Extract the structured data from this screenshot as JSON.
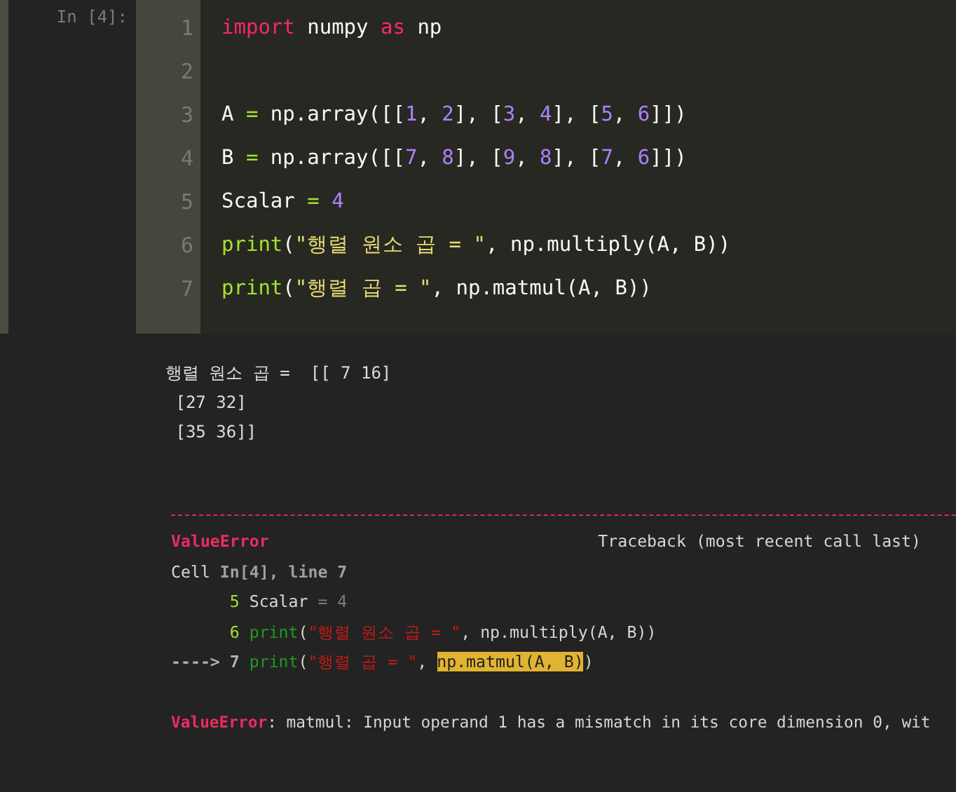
{
  "cell": {
    "prompt": "In [4]:",
    "lines": [
      {
        "number": "1",
        "tokens": [
          {
            "kind": "kw",
            "text": "import"
          },
          {
            "kind": "plain",
            "text": " numpy "
          },
          {
            "kind": "kw",
            "text": "as"
          },
          {
            "kind": "plain",
            "text": " np"
          }
        ]
      },
      {
        "number": "2"
      },
      {
        "number": "3",
        "tokens": [
          {
            "kind": "plain",
            "text": "A "
          },
          {
            "kind": "op",
            "text": "="
          },
          {
            "kind": "plain",
            "text": " np.array([["
          },
          {
            "kind": "num",
            "text": "1"
          },
          {
            "kind": "plain",
            "text": ", "
          },
          {
            "kind": "num",
            "text": "2"
          },
          {
            "kind": "plain",
            "text": "], ["
          },
          {
            "kind": "num",
            "text": "3"
          },
          {
            "kind": "plain",
            "text": ", "
          },
          {
            "kind": "num",
            "text": "4"
          },
          {
            "kind": "plain",
            "text": "], ["
          },
          {
            "kind": "num",
            "text": "5"
          },
          {
            "kind": "plain",
            "text": ", "
          },
          {
            "kind": "num",
            "text": "6"
          },
          {
            "kind": "plain",
            "text": "]])"
          }
        ]
      },
      {
        "number": "4",
        "tokens": [
          {
            "kind": "plain",
            "text": "B "
          },
          {
            "kind": "op",
            "text": "="
          },
          {
            "kind": "plain",
            "text": " np.array([["
          },
          {
            "kind": "num",
            "text": "7"
          },
          {
            "kind": "plain",
            "text": ", "
          },
          {
            "kind": "num",
            "text": "8"
          },
          {
            "kind": "plain",
            "text": "], ["
          },
          {
            "kind": "num",
            "text": "9"
          },
          {
            "kind": "plain",
            "text": ", "
          },
          {
            "kind": "num",
            "text": "8"
          },
          {
            "kind": "plain",
            "text": "], ["
          },
          {
            "kind": "num",
            "text": "7"
          },
          {
            "kind": "plain",
            "text": ", "
          },
          {
            "kind": "num",
            "text": "6"
          },
          {
            "kind": "plain",
            "text": "]])"
          }
        ]
      },
      {
        "number": "5",
        "tokens": [
          {
            "kind": "plain",
            "text": "Scalar "
          },
          {
            "kind": "op",
            "text": "= "
          },
          {
            "kind": "num",
            "text": "4"
          }
        ]
      },
      {
        "number": "6",
        "tokens": [
          {
            "kind": "func",
            "text": "print"
          },
          {
            "kind": "plain",
            "text": "("
          },
          {
            "kind": "str",
            "text": "\"행렬 원소 곱 = \""
          },
          {
            "kind": "plain",
            "text": ", np.multiply(A, B))"
          }
        ]
      },
      {
        "number": "7",
        "tokens": [
          {
            "kind": "func",
            "text": "print"
          },
          {
            "kind": "plain",
            "text": "("
          },
          {
            "kind": "str",
            "text": "\"행렬 곱 = \""
          },
          {
            "kind": "plain",
            "text": ", np.matmul(A, B))"
          }
        ]
      }
    ]
  },
  "output": {
    "lines": [
      "행렬 원소 곱 =  [[ 7 16]",
      " [27 32]",
      " [35 36]]"
    ]
  },
  "traceback": {
    "error_name": "ValueError",
    "header": "Traceback (most recent call last)",
    "location": [
      {
        "kind": "plain",
        "text": "Cell "
      },
      {
        "kind": "loc",
        "text": "In[4], line 7"
      }
    ],
    "lines": [
      [
        {
          "kind": "lineno",
          "text": "5"
        },
        {
          "kind": "plain",
          "text": " Scalar "
        },
        {
          "kind": "dim",
          "text": "= 4"
        }
      ],
      [
        {
          "kind": "lineno",
          "text": "6"
        },
        {
          "kind": "func",
          "text": " print"
        },
        {
          "kind": "plain",
          "text": "("
        },
        {
          "kind": "str",
          "text": "\"행렬 원소 곱 = \""
        },
        {
          "kind": "plain",
          "text": ", np.multiply(A, B))"
        }
      ],
      [
        {
          "kind": "arrow",
          "text": "----> 7"
        },
        {
          "kind": "func",
          "text": " print"
        },
        {
          "kind": "plain",
          "text": "("
        },
        {
          "kind": "str",
          "text": "\"행렬 곱 = \""
        },
        {
          "kind": "plain",
          "text": ", "
        },
        {
          "kind": "hl",
          "text": "np.matmul(A, B)"
        },
        {
          "kind": "plain",
          "text": ")"
        }
      ]
    ],
    "message": [
      {
        "kind": "err",
        "text": "ValueError"
      },
      {
        "kind": "plain",
        "text": ": matmul: Input operand 1 has a mismatch in its core dimension 0, wit"
      }
    ]
  }
}
